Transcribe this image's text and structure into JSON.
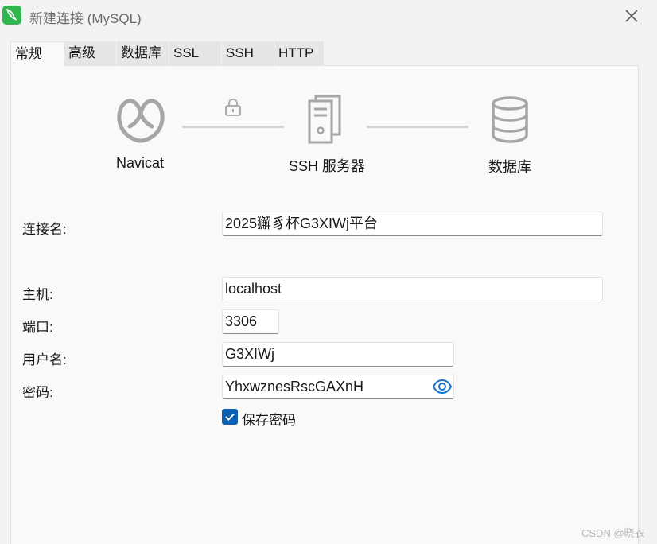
{
  "window": {
    "title": "新建连接 (MySQL)",
    "app_icon": "navicat-dolphin-icon",
    "close_icon": "close-icon"
  },
  "tabs": [
    {
      "label": "常规",
      "active": true
    },
    {
      "label": "高级",
      "active": false
    },
    {
      "label": "数据库",
      "active": false
    },
    {
      "label": "SSL",
      "active": false
    },
    {
      "label": "SSH",
      "active": false
    },
    {
      "label": "HTTP",
      "active": false
    }
  ],
  "diagram": {
    "client": {
      "label": "Navicat",
      "icon": "navicat-logo-icon"
    },
    "link_icon": "lock-icon",
    "server": {
      "label": "SSH 服务器",
      "icon": "server-icon"
    },
    "database": {
      "label": "数据库",
      "icon": "database-icon"
    }
  },
  "form": {
    "connection_name": {
      "label": "连接名:",
      "value": "2025獬豸杯G3XIWj平台"
    },
    "host": {
      "label": "主机:",
      "value": "localhost"
    },
    "port": {
      "label": "端口:",
      "value": "3306"
    },
    "username": {
      "label": "用户名:",
      "value": "G3XIWj"
    },
    "password": {
      "label": "密码:",
      "value": "YhxwznesRscGAXnH",
      "reveal_icon": "eye-icon"
    },
    "save_password": {
      "label": "保存密码",
      "checked": true
    }
  },
  "watermark": "CSDN @晓衣",
  "colors": {
    "accent": "#0a5fb3",
    "icon_gray": "#a6a6a6",
    "app_green": "#30b64d",
    "eye_blue": "#1a73c8"
  }
}
